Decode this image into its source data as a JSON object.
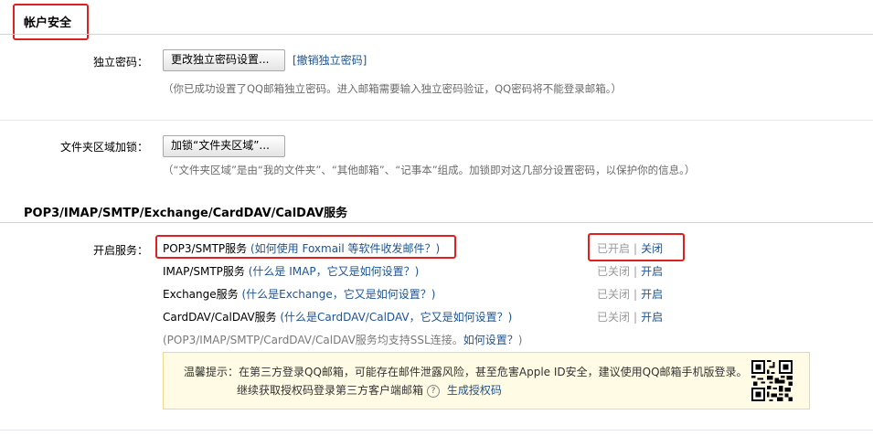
{
  "account_security": {
    "title": "帐户安全",
    "independent_password": {
      "label": "独立密码：",
      "change_button": "更改独立密码设置...",
      "revoke_link": "[撤销独立密码]",
      "hint": "（你已成功设置了QQ邮箱独立密码。进入邮箱需要输入独立密码验证，QQ密码将不能登录邮箱。）"
    },
    "folder_lock": {
      "label": "文件夹区域加锁：",
      "lock_button": "加锁“文件夹区域”...",
      "hint": "（“文件夹区域”是由“我的文件夹”、“其他邮箱”、“记事本”组成。加锁即对这几部分设置密码，以保护你的信息。）"
    }
  },
  "services": {
    "title": "POP3/IMAP/SMTP/Exchange/CardDAV/CalDAV服务",
    "label": "开启服务：",
    "items": [
      {
        "name": "POP3/SMTP服务",
        "help": "(如何使用 Foxmail 等软件收发邮件？)",
        "status": "已开启",
        "action": "关闭"
      },
      {
        "name": "IMAP/SMTP服务",
        "help": "(什么是 IMAP，它又是如何设置？)",
        "status": "已关闭",
        "action": "开启"
      },
      {
        "name": "Exchange服务",
        "help": "(什么是Exchange，它又是如何设置？)",
        "status": "已关闭",
        "action": "开启"
      },
      {
        "name": "CardDAV/CalDAV服务",
        "help": "(什么是CardDAV/CalDAV，它又是如何设置？)",
        "status": "已关闭",
        "action": "开启"
      }
    ],
    "ssl_note": "(POP3/IMAP/SMTP/CardDAV/CalDAV服务均支持SSL连接。",
    "ssl_link": "如何设置？",
    "ssl_close": ")",
    "tip": {
      "line1": "温馨提示：在第三方登录QQ邮箱，可能存在邮件泄露风险，甚至危害Apple ID安全，建议使用QQ邮箱手机版登录。",
      "line2": "继续获取授权码登录第三方客户端邮箱",
      "help_glyph": "?",
      "link": "生成授权码"
    }
  },
  "colors": {
    "link": "#1e5494",
    "highlight_border": "#e02020",
    "tip_background": "#fffbe4",
    "divider": "#c5d9ea"
  }
}
